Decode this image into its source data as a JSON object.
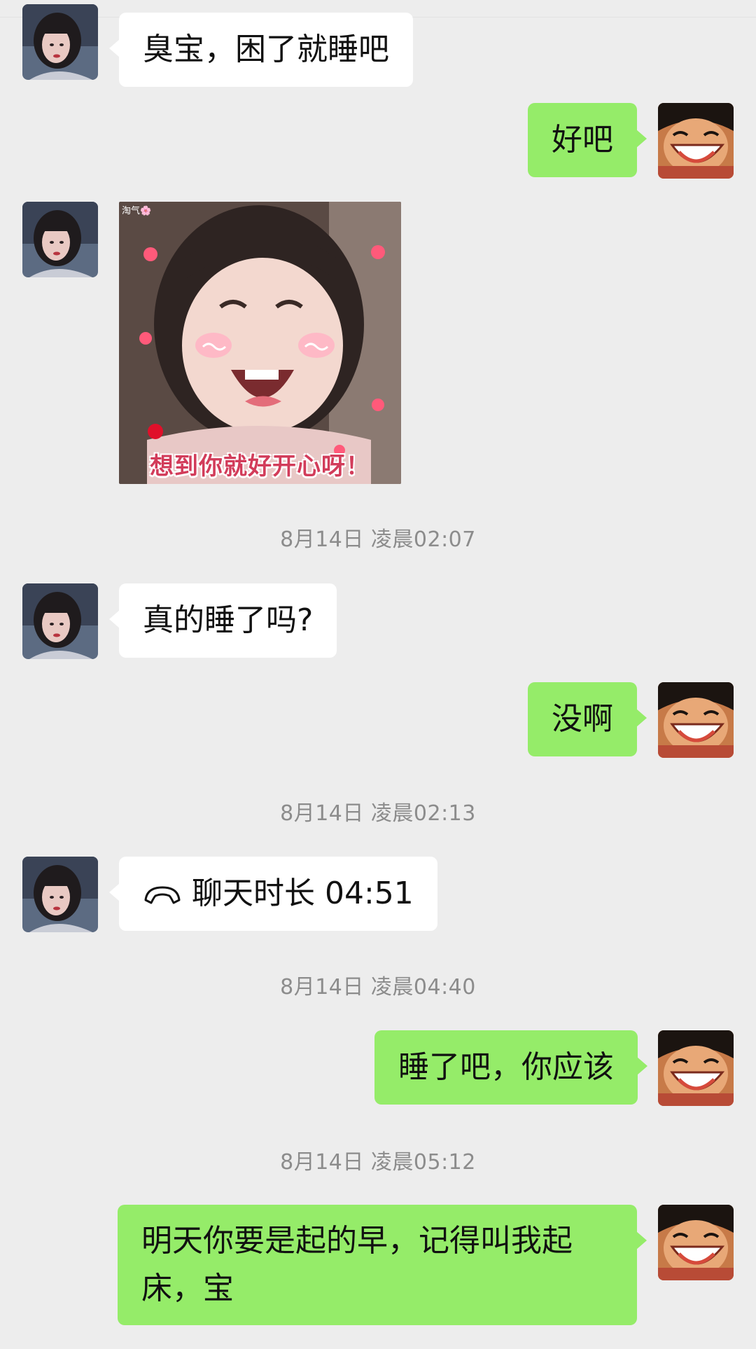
{
  "messages": [
    {
      "id": "m1",
      "side": "in",
      "type": "text",
      "text": "臭宝，困了就睡吧"
    },
    {
      "id": "m2",
      "side": "out",
      "type": "text",
      "text": "好吧"
    },
    {
      "id": "m3",
      "side": "in",
      "type": "sticker",
      "caption": "想到你就好开心呀！",
      "watermark": "淘气🌸",
      "icon": "smiling-baby-sticker"
    },
    {
      "id": "t1",
      "type": "timestamp",
      "text": "8月14日 凌晨02:07"
    },
    {
      "id": "m4",
      "side": "in",
      "type": "text",
      "text": "真的睡了吗?"
    },
    {
      "id": "m5",
      "side": "out",
      "type": "text",
      "text": "没啊"
    },
    {
      "id": "t2",
      "type": "timestamp",
      "text": "8月14日 凌晨02:13"
    },
    {
      "id": "m6",
      "side": "in",
      "type": "call",
      "text": "聊天时长 04:51",
      "icon": "phone-hangup-icon"
    },
    {
      "id": "t3",
      "type": "timestamp",
      "text": "8月14日 凌晨04:40"
    },
    {
      "id": "m7",
      "side": "out",
      "type": "text",
      "text": "睡了吧，你应该"
    },
    {
      "id": "t4",
      "type": "timestamp",
      "text": "8月14日 凌晨05:12"
    },
    {
      "id": "m8",
      "side": "out",
      "type": "text",
      "text": "明天你要是起的早，记得叫我起床，宝"
    }
  ],
  "colors": {
    "background": "#ededed",
    "incoming_bubble": "#ffffff",
    "outgoing_bubble": "#95ec69",
    "timestamp_text": "#8c8c8c"
  },
  "avatars": {
    "contact": "contact-avatar-woman",
    "self": "self-avatar-cartoon-laughing"
  }
}
